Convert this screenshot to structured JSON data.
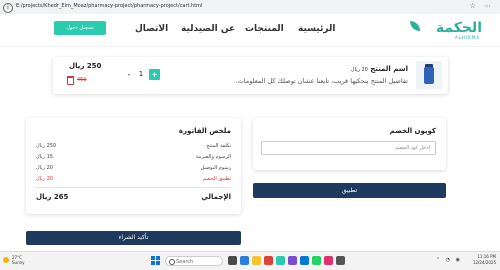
{
  "browser": {
    "url": "E:/projects/Khedr_Elm_Moaz/pharmacy-project/pharmacy-project/cart.html"
  },
  "header": {
    "logo_ar": "الحكمة",
    "logo_en": "ALHIKMA",
    "nav": {
      "home": "الرئيسية",
      "products": "المنتجات",
      "about": "عن الصيدلية",
      "contact": "الاتصال"
    },
    "login_label": "تسجيل دخول",
    "accent_color": "#2bcbb2"
  },
  "cart_item": {
    "name": "اسم المنتج",
    "inline_price": "20 ريال",
    "description": "تفاصيل المنتج بنحكيها قريب، تابعنا عشان توصلك كل المعلومات.",
    "quantity": "1",
    "plus": "+",
    "minus": "-",
    "price": "250 ريال",
    "old_price": "45$"
  },
  "coupon": {
    "title": "كوبون الخصم",
    "placeholder": "ادخل كود الخصم",
    "apply_label": "تطبيق"
  },
  "invoice": {
    "title": "ملخص الفاتورة",
    "rows": [
      {
        "label": "تكلفة المنتج",
        "value": "250 ريال"
      },
      {
        "label": "الرسوم والضريبة",
        "value": "15 ريال"
      },
      {
        "label": "رسوم التوصيل",
        "value": "20 ريال"
      },
      {
        "label": "تطبيق الخصم",
        "value": "20 ريال"
      }
    ],
    "total_label": "الإجمالي",
    "total_value": "265 ريال",
    "confirm_label": "تأكيد الشراء"
  },
  "taskbar": {
    "weather_temp": "27°C",
    "weather_text": "Sunny",
    "search_placeholder": "Search",
    "time": "11:16 PM",
    "date": "12/24/2025"
  }
}
